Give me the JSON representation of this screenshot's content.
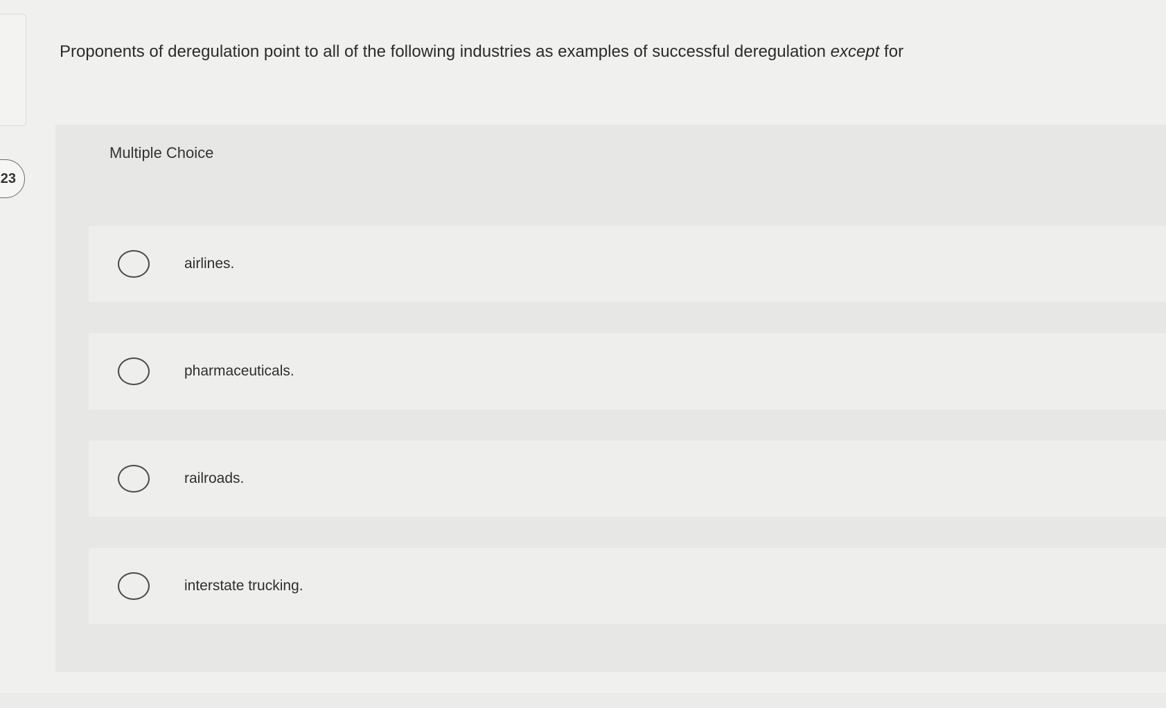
{
  "sidebar": {
    "question_number": "23"
  },
  "question": {
    "text_before": "Proponents of deregulation point to all of the following industries as examples of successful deregulation ",
    "text_emphasis": "except",
    "text_after": " for"
  },
  "choices": {
    "header": "Multiple Choice",
    "options": [
      {
        "label": "airlines."
      },
      {
        "label": "pharmaceuticals."
      },
      {
        "label": "railroads."
      },
      {
        "label": "interstate trucking."
      }
    ]
  }
}
